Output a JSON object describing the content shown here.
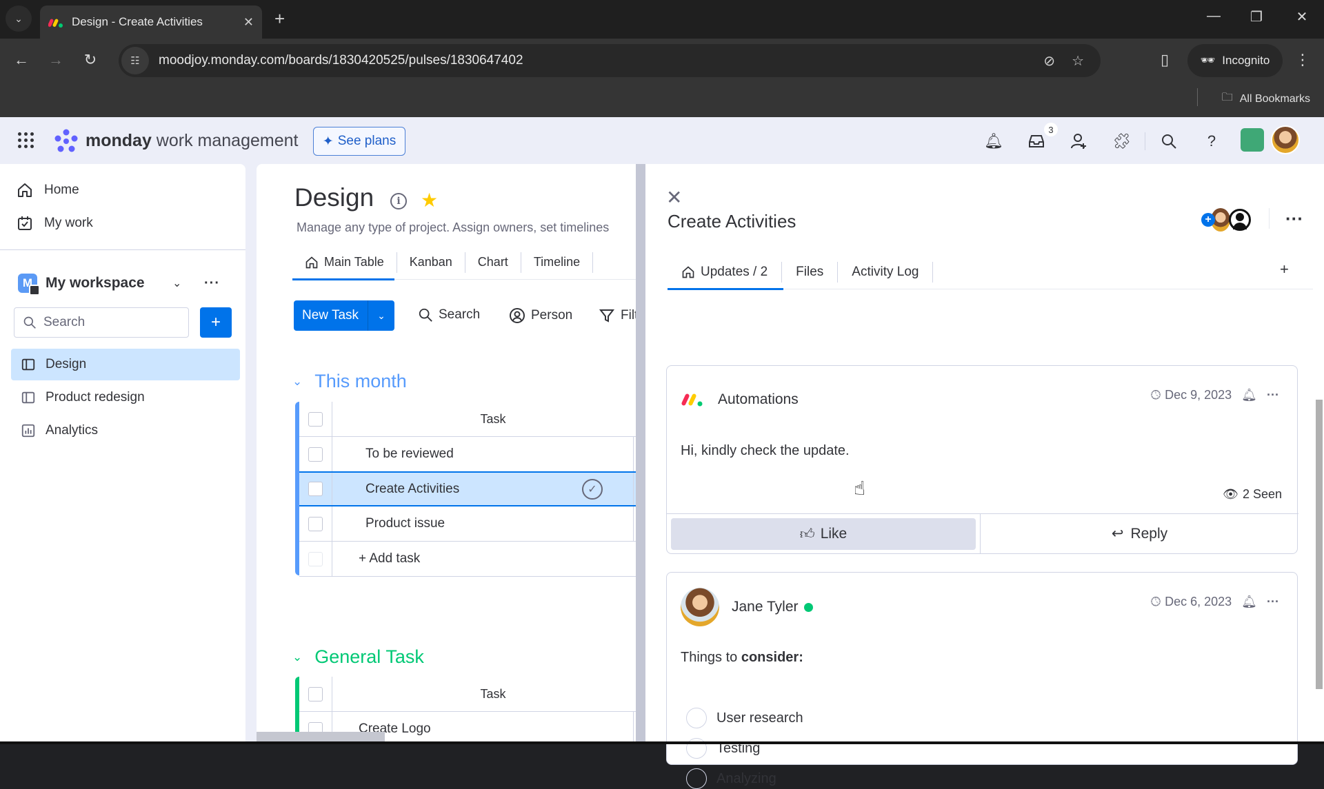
{
  "browser": {
    "tab_title": "Design - Create Activities",
    "url": "moodjoy.monday.com/boards/1830420525/pulses/1830647402",
    "incognito_label": "Incognito",
    "bookmarks_label": "All Bookmarks",
    "icons": [
      "tab-dropdown-icon",
      "close-icon",
      "new-tab-icon",
      "minimize-icon",
      "restore-icon",
      "close-window-icon",
      "back-icon",
      "forward-icon",
      "reload-icon",
      "site-info-icon",
      "eye-off-icon",
      "star-icon",
      "side-panel-icon",
      "incognito-icon",
      "more-vert-icon",
      "folder-icon"
    ]
  },
  "header": {
    "brand_bold": "monday",
    "brand_rest": " work management",
    "see_plans": "See plans",
    "inbox_badge": "3",
    "icons": [
      "bell-icon",
      "inbox-icon",
      "invite-user-icon",
      "puzzle-icon",
      "search-icon",
      "help-icon"
    ]
  },
  "sidebar": {
    "home": "Home",
    "my_work": "My work",
    "workspace_initial": "M",
    "workspace_name": "My workspace",
    "search_placeholder": "Search",
    "add_label": "+",
    "boards": [
      {
        "label": "Design",
        "icon": "board-icon",
        "active": true
      },
      {
        "label": "Product redesign",
        "icon": "board-icon",
        "active": false
      },
      {
        "label": "Analytics",
        "icon": "dashboard-icon",
        "active": false
      }
    ]
  },
  "board": {
    "title": "Design",
    "description": "Manage any type of project. Assign owners, set timelines",
    "views": [
      "Main Table",
      "Kanban",
      "Chart",
      "Timeline"
    ],
    "new_task": "New Task",
    "toolbar": {
      "search": "Search",
      "person": "Person",
      "filter": "Filter"
    },
    "groups": [
      {
        "title": "This month",
        "color": "#579bfc",
        "header": "Task",
        "rows": [
          "To be reviewed",
          "Create Activities",
          "Product issue"
        ],
        "selected_row": "Create Activities",
        "add_task": "+ Add task"
      },
      {
        "title": "General Task",
        "color": "#00c875",
        "header": "Task",
        "rows": [
          "Create Logo"
        ]
      }
    ]
  },
  "panel": {
    "title": "Create Activities",
    "tabs": [
      "Updates / 2",
      "Files",
      "Activity Log"
    ],
    "active_tab": "Updates / 2",
    "updates": [
      {
        "author": "Automations",
        "date": "Dec 9, 2023",
        "body": "Hi, kindly check the update.",
        "seen": "2 Seen",
        "like": "Like",
        "reply": "Reply"
      },
      {
        "author": "Jane Tyler",
        "online": true,
        "date": "Dec 6, 2023",
        "body_plain": "Things to ",
        "body_bold": "consider:",
        "checklist": [
          "User research",
          "Testing",
          "Analyzing"
        ]
      }
    ]
  }
}
